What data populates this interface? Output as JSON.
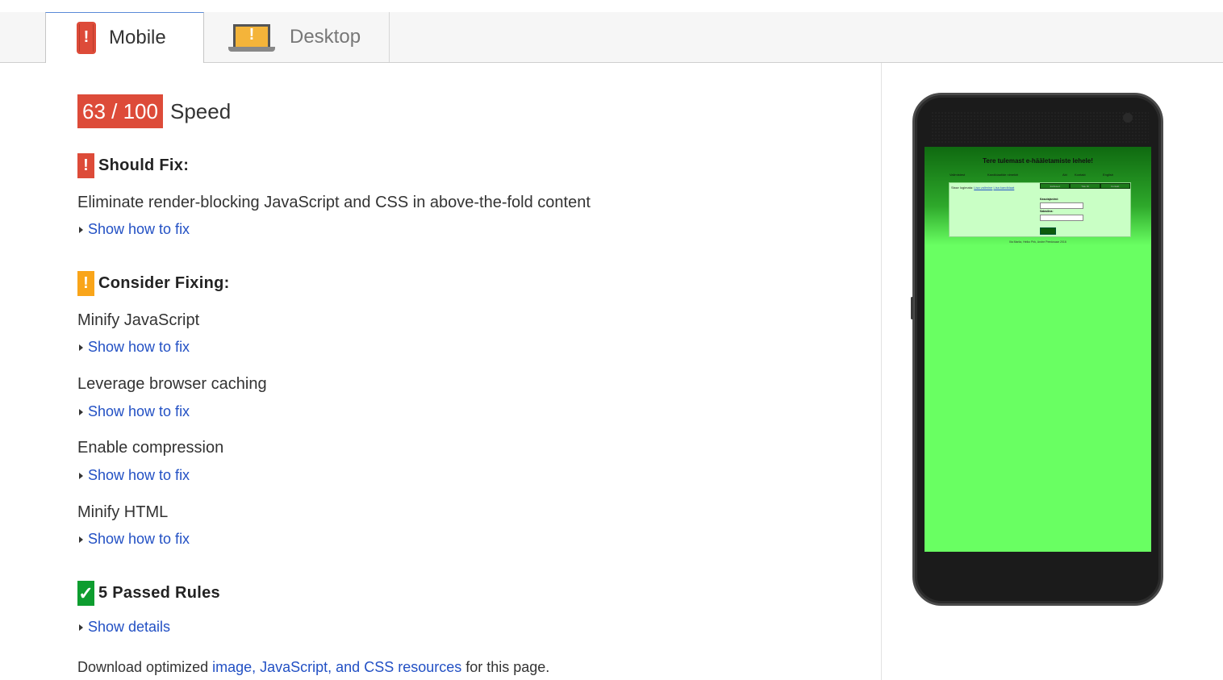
{
  "tabs": {
    "mobile": "Mobile",
    "desktop": "Desktop"
  },
  "score": {
    "value": "63 / 100",
    "label": "Speed",
    "color": "#dd4b39"
  },
  "should_fix": {
    "title": "Should Fix:",
    "rules": [
      {
        "name": "Eliminate render-blocking JavaScript and CSS in above-the-fold content",
        "link": "Show how to fix"
      }
    ]
  },
  "consider_fixing": {
    "title": "Consider Fixing:",
    "rules": [
      {
        "name": "Minify JavaScript",
        "link": "Show how to fix"
      },
      {
        "name": "Leverage browser caching",
        "link": "Show how to fix"
      },
      {
        "name": "Enable compression",
        "link": "Show how to fix"
      },
      {
        "name": "Minify HTML",
        "link": "Show how to fix"
      }
    ]
  },
  "passed": {
    "title": "5 Passed Rules",
    "link": "Show details"
  },
  "footer": {
    "prefix": "Download optimized ",
    "link": "image, JavaScript, and CSS resources",
    "suffix": " for this page."
  },
  "preview": {
    "site_title": "Tere tulemast e-hääletamiste lehele!",
    "nav": [
      "Valimistest",
      "Kandidaatide nimekiri",
      "Abi",
      "Kontakt",
      "English"
    ],
    "panel_text": "Sisse logimata: ",
    "panel_links": [
      "Lisa valimine",
      "Lisa kandidaat"
    ],
    "panel_buttons": [
      "Esitlused",
      "Tule ID",
      "Kontakt"
    ],
    "username_label": "Kasutajanimi:",
    "password_label": "Salasõna:",
    "footer_text": "Ilia Mariia, Heiko Pirk, Andre Peedosaar 2016"
  }
}
